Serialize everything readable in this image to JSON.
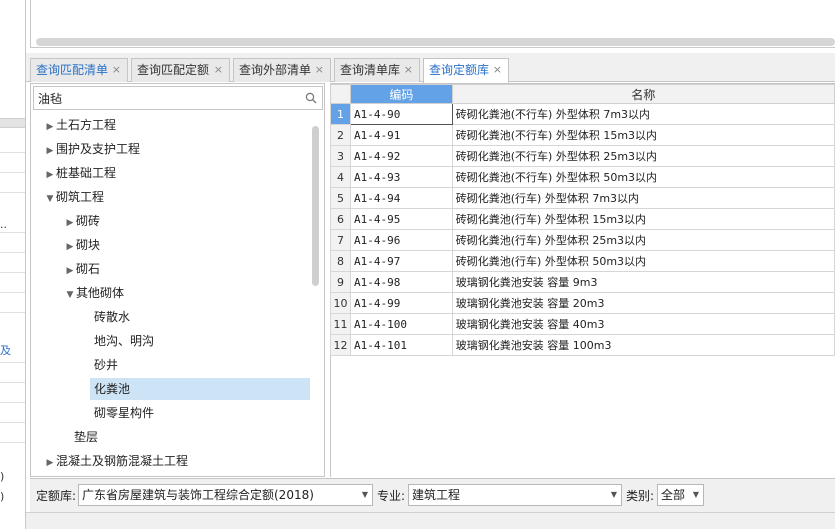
{
  "left_strip": {
    "fragments": [
      "..",
      "及",
      ")",
      ")"
    ]
  },
  "tabs": [
    {
      "label": "查询匹配清单",
      "close": "×"
    },
    {
      "label": "查询匹配定额",
      "close": "×"
    },
    {
      "label": "查询外部清单",
      "close": "×"
    },
    {
      "label": "查询清单库",
      "close": "×"
    },
    {
      "label": "查询定额库",
      "close": "×"
    }
  ],
  "search": {
    "value": "油毡"
  },
  "tree": [
    {
      "label": "土石方工程",
      "arrow": "▶"
    },
    {
      "label": "围护及支护工程",
      "arrow": "▶"
    },
    {
      "label": "桩基础工程",
      "arrow": "▶"
    },
    {
      "label": "砌筑工程",
      "arrow": "▼"
    },
    {
      "label": "砌砖",
      "arrow": "▶"
    },
    {
      "label": "砌块",
      "arrow": "▶"
    },
    {
      "label": "砌石",
      "arrow": "▶"
    },
    {
      "label": "其他砌体",
      "arrow": "▼"
    },
    {
      "label": "砖散水",
      "arrow": ""
    },
    {
      "label": "地沟、明沟",
      "arrow": ""
    },
    {
      "label": "砂井",
      "arrow": ""
    },
    {
      "label": "化粪池",
      "arrow": ""
    },
    {
      "label": "砌零星构件",
      "arrow": ""
    },
    {
      "label": "垫层",
      "arrow": ""
    },
    {
      "label": "混凝土及钢筋混凝土工程",
      "arrow": "▶"
    }
  ],
  "grid": {
    "headers": {
      "code": "编码",
      "name": "名称"
    },
    "rows": [
      {
        "n": "1",
        "code": "A1-4-90",
        "name": "砖砌化粪池(不行车) 外型体积 7m3以内"
      },
      {
        "n": "2",
        "code": "A1-4-91",
        "name": "砖砌化粪池(不行车) 外型体积 15m3以内"
      },
      {
        "n": "3",
        "code": "A1-4-92",
        "name": "砖砌化粪池(不行车) 外型体积 25m3以内"
      },
      {
        "n": "4",
        "code": "A1-4-93",
        "name": "砖砌化粪池(不行车) 外型体积 50m3以内"
      },
      {
        "n": "5",
        "code": "A1-4-94",
        "name": "砖砌化粪池(行车) 外型体积 7m3以内"
      },
      {
        "n": "6",
        "code": "A1-4-95",
        "name": "砖砌化粪池(行车) 外型体积 15m3以内"
      },
      {
        "n": "7",
        "code": "A1-4-96",
        "name": "砖砌化粪池(行车) 外型体积 25m3以内"
      },
      {
        "n": "8",
        "code": "A1-4-97",
        "name": "砖砌化粪池(行车) 外型体积 50m3以内"
      },
      {
        "n": "9",
        "code": "A1-4-98",
        "name": "玻璃钢化粪池安装 容量 9m3"
      },
      {
        "n": "10",
        "code": "A1-4-99",
        "name": "玻璃钢化粪池安装 容量 20m3"
      },
      {
        "n": "11",
        "code": "A1-4-100",
        "name": "玻璃钢化粪池安装 容量 40m3"
      },
      {
        "n": "12",
        "code": "A1-4-101",
        "name": "玻璃钢化粪池安装 容量 100m3"
      }
    ]
  },
  "bottom": {
    "library_label": "定额库:",
    "library_value": "广东省房屋建筑与装饰工程综合定额(2018)",
    "major_label": "专业:",
    "major_value": "建筑工程",
    "category_label": "类别:",
    "category_value": "全部",
    "dropdown_glyph": "▼"
  },
  "colors": {
    "accent": "#2a71c8",
    "header_highlight": "#63a2e6",
    "selection": "#cde4f7"
  }
}
